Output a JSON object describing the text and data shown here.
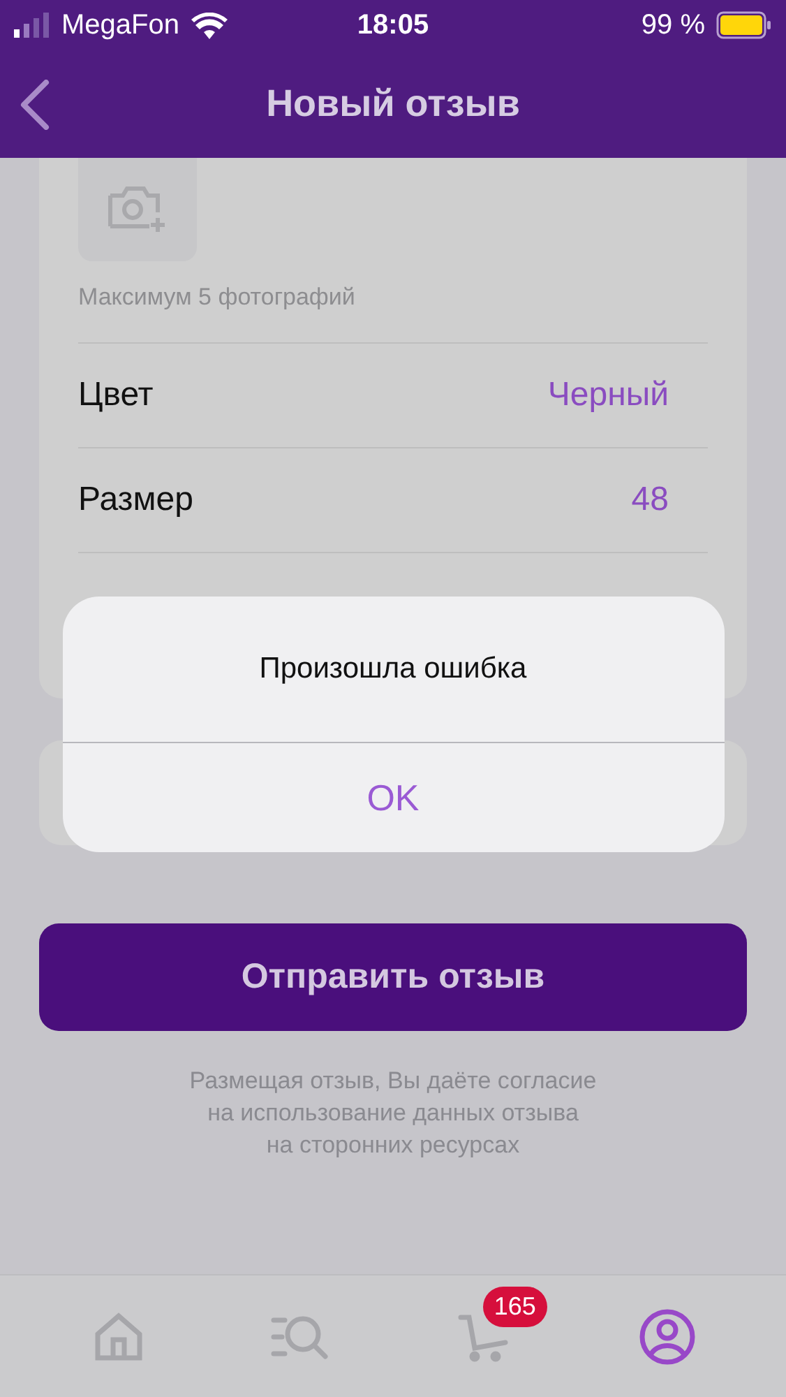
{
  "status_bar": {
    "carrier": "MegaFon",
    "time": "18:05",
    "battery": "99 %"
  },
  "nav": {
    "title": "Новый отзыв"
  },
  "photos": {
    "caption": "Максимум 5 фотографий"
  },
  "attributes": [
    {
      "label": "Цвет",
      "value": "Черный"
    },
    {
      "label": "Размер",
      "value": "48"
    }
  ],
  "submit_button": "Отправить отзыв",
  "consent": "Размещая отзыв, Вы даёте согласие\nна использование данных отзыва\nна сторонних ресурсах",
  "alert": {
    "title": "Произошла ошибка",
    "button": "OK"
  },
  "tab_bar": [
    {
      "kind": "home",
      "selected": false
    },
    {
      "kind": "catalog",
      "selected": false
    },
    {
      "kind": "cart",
      "selected": false,
      "badge": "165"
    },
    {
      "kind": "profile",
      "selected": true
    }
  ]
}
